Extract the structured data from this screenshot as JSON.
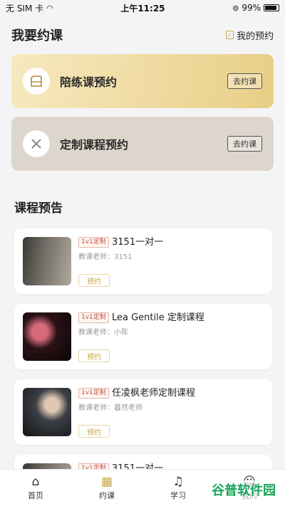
{
  "status_bar": {
    "carrier": "无 SIM 卡",
    "time": "上午11:25",
    "battery": "99%"
  },
  "header": {
    "title": "我要约课",
    "my_reservation": "我的预约"
  },
  "cards": [
    {
      "label": "陪练课预约",
      "button": "去约课",
      "icon": "piano-icon"
    },
    {
      "label": "定制课程预约",
      "button": "去约课",
      "icon": "tools-icon"
    }
  ],
  "section_title": "课程预告",
  "courses": [
    {
      "tag": "1v1定制",
      "name": "3151一对一",
      "teacher": "教课老师：3151",
      "button": "预约"
    },
    {
      "tag": "1v1定制",
      "name": "Lea Gentile 定制课程",
      "teacher": "教课老师：小陈",
      "button": "预约"
    },
    {
      "tag": "1v1定制",
      "name": "任凌枫老师定制课程",
      "teacher": "教课老师：暮然老师",
      "button": "预约"
    },
    {
      "tag": "1v1定制",
      "name": "3151一对一"
    }
  ],
  "tabbar": [
    {
      "label": "首页",
      "icon": "home-icon"
    },
    {
      "label": "约课",
      "icon": "calendar-icon",
      "active": true
    },
    {
      "label": "学习",
      "icon": "music-note-icon"
    },
    {
      "label": "我的",
      "icon": "user-icon"
    }
  ],
  "watermark": "谷普软件园",
  "colors": {
    "accent": "#c9a845",
    "tag_red": "#c34d3a",
    "card1_gold": "#e8cf86",
    "card2_grey": "#dcd6cc"
  }
}
